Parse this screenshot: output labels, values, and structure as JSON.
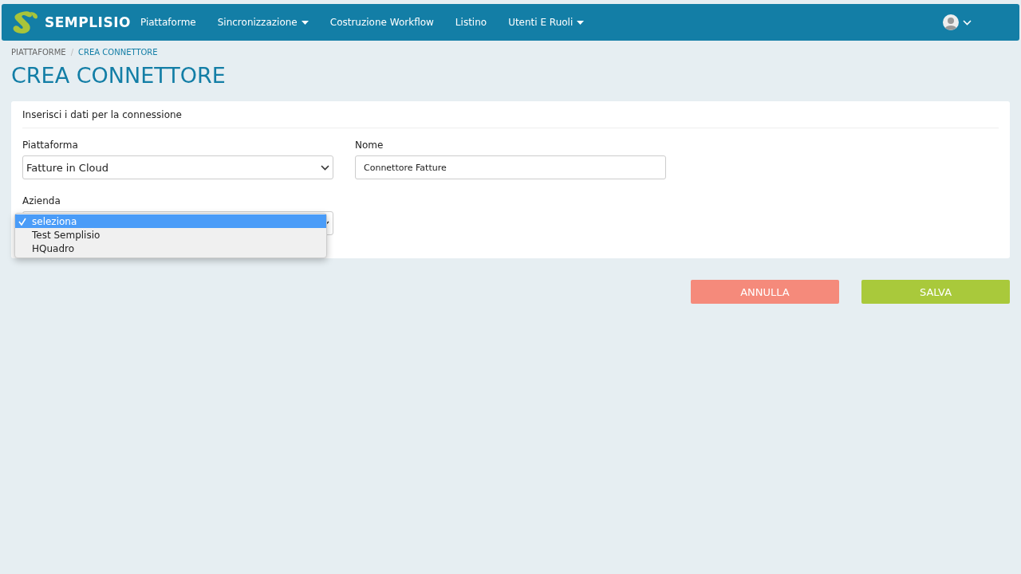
{
  "navbar": {
    "brand": "SEMPLISIO",
    "items": [
      {
        "label": "Piattaforme",
        "dropdown": false
      },
      {
        "label": "Sincronizzazione",
        "dropdown": true
      },
      {
        "label": "Costruzione Workflow",
        "dropdown": false
      },
      {
        "label": "Listino",
        "dropdown": false
      },
      {
        "label": "Utenti E Ruoli",
        "dropdown": true
      }
    ]
  },
  "breadcrumb_separator": "/",
  "breadcrumb": [
    {
      "label": "PIATTAFORME",
      "current": false
    },
    {
      "label": "CREA CONNETTORE",
      "current": true
    }
  ],
  "page_title": "CREA CONNETTORE",
  "form": {
    "heading": "Inserisci i dati per la connessione",
    "piattaforma": {
      "label": "Piattaforma",
      "value": "Fatture in Cloud"
    },
    "nome": {
      "label": "Nome",
      "value": "Connettore Fatture"
    },
    "azienda": {
      "label": "Azienda",
      "expanded": true,
      "options": [
        {
          "label": "seleziona",
          "selected": true
        },
        {
          "label": "Test Semplisio",
          "selected": false
        },
        {
          "label": "HQuadro",
          "selected": false
        }
      ]
    }
  },
  "buttons": [
    {
      "label": "ANNULLA",
      "kind": "cancel"
    },
    {
      "label": "SALVA",
      "kind": "save"
    }
  ]
}
